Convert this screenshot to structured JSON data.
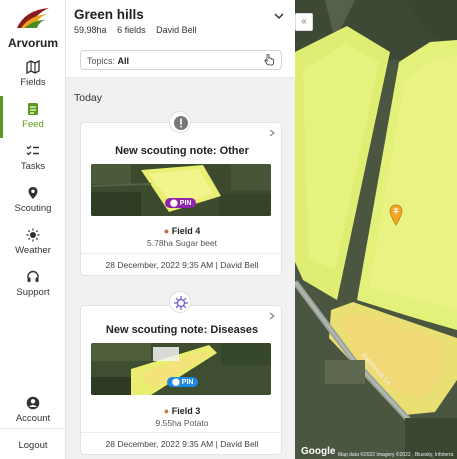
{
  "app": {
    "brand": "Arvorum"
  },
  "sidebar": {
    "items": [
      {
        "label": "Fields",
        "icon": "map-icon"
      },
      {
        "label": "Feed",
        "icon": "feed-icon",
        "active": true
      },
      {
        "label": "Tasks",
        "icon": "tasks-icon"
      },
      {
        "label": "Scouting",
        "icon": "location-pin-icon"
      },
      {
        "label": "Weather",
        "icon": "sun-icon"
      },
      {
        "label": "Support",
        "icon": "headset-icon"
      }
    ],
    "account": "Account",
    "logout": "Logout"
  },
  "header": {
    "farm_name": "Green hills",
    "area": "59.98ha",
    "fields": "6 fields",
    "owner": "David Bell"
  },
  "filter": {
    "label": "Topics:",
    "value": "All"
  },
  "feed": {
    "day": "Today",
    "cards": [
      {
        "title": "New scouting note: Other",
        "badge_icon": "exclamation-icon",
        "pin_label": "PIN",
        "pin_color": "#8e24aa",
        "field": "Field 4",
        "field_icon": "sugar-beet-icon",
        "details": "5.78ha Sugar beet",
        "date": "28 December, 2022 9:35 AM",
        "author": "David Bell"
      },
      {
        "title": "New scouting note: Diseases",
        "badge_icon": "virus-icon",
        "pin_label": "PIN",
        "pin_color": "#1e88e5",
        "field": "Field 3",
        "field_icon": "potato-icon",
        "details": "9.55ha Potato",
        "date": "28 December, 2022 9:35 AM",
        "author": "David Bell"
      }
    ]
  },
  "map": {
    "road_label": "Palmbrook Ln",
    "credit": "Map data ©2022 Imagery ©2022 , Bluesky, Infoterra",
    "google": "Google"
  },
  "colors": {
    "accent": "#5a9a1a",
    "field_yellow": "#e8f06a",
    "pin_orange": "#f5a623"
  }
}
